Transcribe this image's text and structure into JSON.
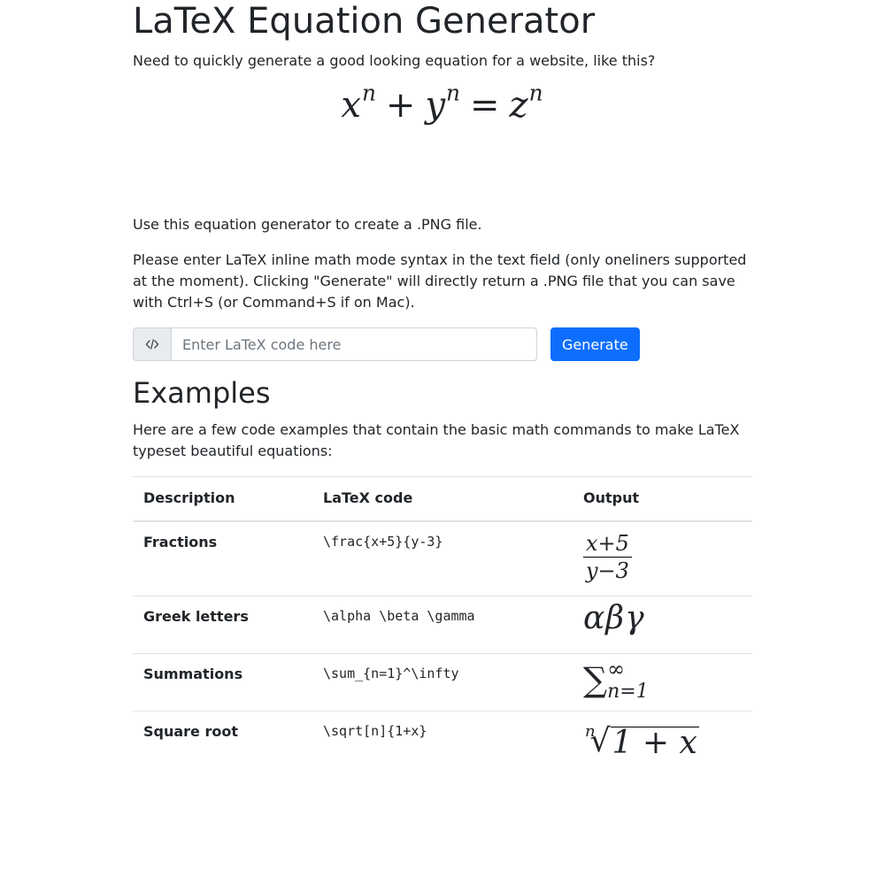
{
  "header": {
    "title": "LaTeX Equation Generator",
    "intro": "Need to quickly generate a good looking equation for a website, like this?"
  },
  "hero_equation": {
    "text": "x^n + y^n = z^n",
    "parts": [
      "x",
      "n",
      "+",
      "y",
      "n",
      "=",
      "z",
      "n"
    ]
  },
  "body": {
    "use_line": "Use this equation generator to create a .PNG file.",
    "instructions": "Please enter LaTeX inline math mode syntax in the text field (only oneliners supported at the moment). Clicking \"Generate\" will directly return a .PNG file that you can save with Ctrl+S (or Command+S if on Mac)."
  },
  "form": {
    "prepend_icon": "code-icon",
    "input_placeholder": "Enter LaTeX code here",
    "input_value": "",
    "generate_label": "Generate"
  },
  "examples": {
    "title": "Examples",
    "description": "Here are a few code examples that contain the basic math commands to make LaTeX typeset beautiful equations:",
    "columns": [
      "Description",
      "LaTeX code",
      "Output"
    ],
    "rows": [
      {
        "description": "Fractions",
        "code": "\\frac{x+5}{y-3}",
        "output": {
          "numerator": "x+5",
          "denominator": "y−3"
        }
      },
      {
        "description": "Greek letters",
        "code": "\\alpha \\beta \\gamma",
        "output": {
          "text": "αβγ"
        }
      },
      {
        "description": "Summations",
        "code": "\\sum_{n=1}^\\infty",
        "output": {
          "symbol": "∑",
          "upper": "∞",
          "lower": "n=1"
        }
      },
      {
        "description": "Square root",
        "code": "\\sqrt[n]{1+x}",
        "output": {
          "index": "n",
          "symbol": "√",
          "radicand": "1 + x"
        }
      }
    ]
  },
  "colors": {
    "primary_button": "#0d6efd",
    "text": "#212529",
    "border": "#dee2e6"
  }
}
